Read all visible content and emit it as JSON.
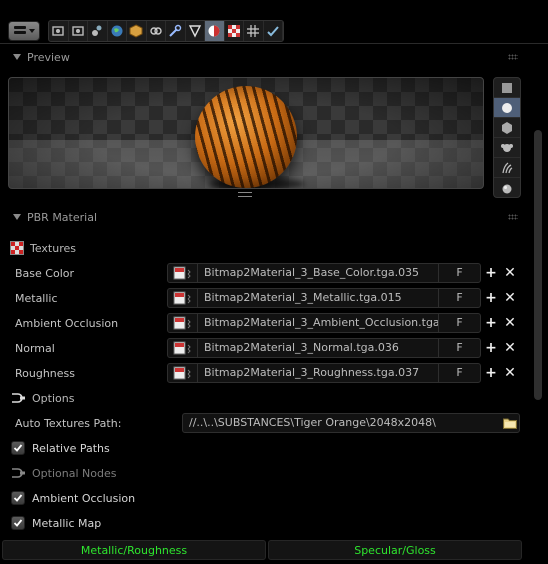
{
  "header": {
    "context_tabs": [
      {
        "icon": "render-icon",
        "active": false
      },
      {
        "icon": "render-layers-icon",
        "active": false
      },
      {
        "icon": "scene-icon",
        "active": false
      },
      {
        "icon": "world-icon",
        "active": false
      },
      {
        "icon": "object-icon",
        "active": false
      },
      {
        "icon": "constraints-icon",
        "active": false
      },
      {
        "icon": "modifiers-icon",
        "active": false
      },
      {
        "icon": "data-icon",
        "active": false
      },
      {
        "icon": "material-icon",
        "active": true
      },
      {
        "icon": "texture-icon",
        "active": false
      },
      {
        "icon": "particles-icon",
        "active": false
      },
      {
        "icon": "physics-icon",
        "active": false
      }
    ]
  },
  "preview_panel": {
    "title": "Preview",
    "types": [
      "flat-icon",
      "sphere-icon",
      "cube-icon",
      "monkey-icon",
      "hair-icon",
      "sphere-sky-icon"
    ],
    "active_type": 1
  },
  "pbr_panel": {
    "title": "PBR Material",
    "textures_header": "Textures",
    "rows": [
      {
        "label": "Base Color",
        "texture": "Bitmap2Material_3_Base_Color.tga.035",
        "f": "F"
      },
      {
        "label": "Metallic",
        "texture": "Bitmap2Material_3_Metallic.tga.015",
        "f": "F"
      },
      {
        "label": "Ambient Occlusion",
        "texture": "Bitmap2Material_3_Ambient_Occlusion.tga....",
        "f": "F"
      },
      {
        "label": "Normal",
        "texture": "Bitmap2Material_3_Normal.tga.036",
        "f": "F"
      },
      {
        "label": "Roughness",
        "texture": "Bitmap2Material_3_Roughness.tga.037",
        "f": "F"
      }
    ],
    "options_header": "Options",
    "auto_textures_label": "Auto Textures Path:",
    "auto_textures_path": "//..\\..\\SUBSTANCES\\Tiger Orange\\2048x2048\\",
    "relative_paths": {
      "label": "Relative Paths",
      "checked": true
    },
    "optional_nodes_header": "Optional Nodes",
    "ambient_occlusion": {
      "label": "Ambient Occlusion",
      "checked": true
    },
    "metallic_map": {
      "label": "Metallic Map",
      "checked": true
    },
    "workflow_buttons": [
      "Metallic/Roughness",
      "Specular/Gloss"
    ],
    "workflow_color": "#2ee62e"
  }
}
